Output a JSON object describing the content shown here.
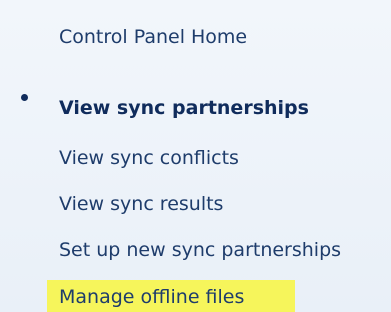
{
  "sidebar": {
    "items": [
      {
        "label": "Control Panel Home"
      },
      {
        "label": "View sync partnerships",
        "active": true
      },
      {
        "label": "View sync conflicts"
      },
      {
        "label": "View sync results"
      },
      {
        "label": "Set up new sync partnerships"
      },
      {
        "label": "Manage offline files",
        "highlighted": true
      }
    ]
  },
  "colors": {
    "link": "#1e3c6b",
    "active_link": "#102c5c",
    "highlight": "#f6f55b",
    "background": "#eef3f9"
  }
}
